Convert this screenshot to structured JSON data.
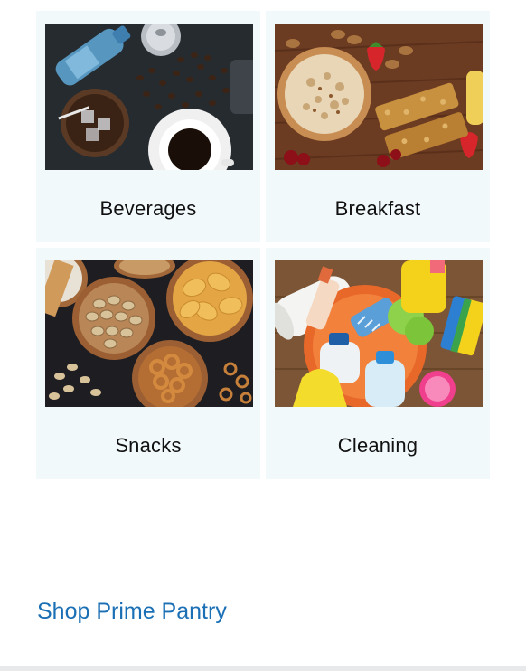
{
  "categories": [
    {
      "label": "Beverages",
      "image": "beverages-photo"
    },
    {
      "label": "Breakfast",
      "image": "breakfast-photo"
    },
    {
      "label": "Snacks",
      "image": "snacks-photo"
    },
    {
      "label": "Cleaning",
      "image": "cleaning-photo"
    }
  ],
  "footer_link": {
    "label": "Shop Prime Pantry"
  },
  "colors": {
    "tile_background": "#f2f9fb",
    "link": "#1a6fb5",
    "text": "#111111",
    "bottom_bar": "#e7e9eb"
  }
}
